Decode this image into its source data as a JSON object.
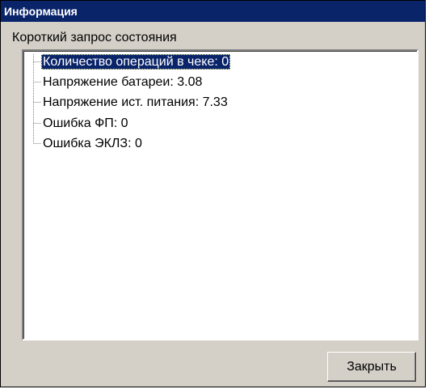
{
  "window": {
    "title": "Информация"
  },
  "group": {
    "label": "Короткий запрос состояния"
  },
  "tree": {
    "items": [
      {
        "label": "Количество операций в чеке: 0",
        "selected": true
      },
      {
        "label": "Напряжение батареи: 3.08",
        "selected": false
      },
      {
        "label": "Напряжение ист. питания: 7.33",
        "selected": false
      },
      {
        "label": "Ошибка ФП: 0",
        "selected": false
      },
      {
        "label": "Ошибка ЭКЛЗ: 0",
        "selected": false
      }
    ]
  },
  "buttons": {
    "close_label": "Закрыть"
  },
  "colors": {
    "titlebar": "#0a246a",
    "window_face": "#d4d0c8",
    "selection": "#0a246a"
  }
}
